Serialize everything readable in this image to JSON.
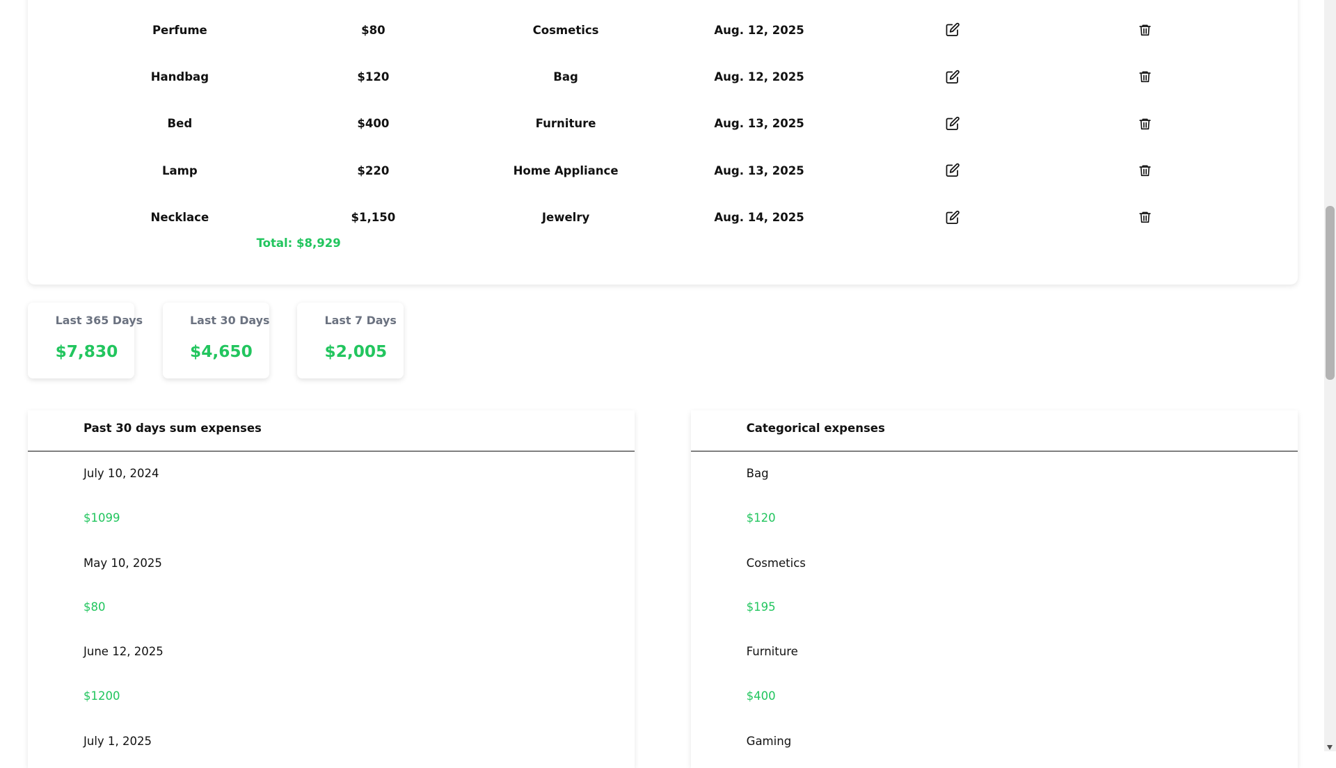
{
  "expenses": [
    {
      "name": "Perfume",
      "amount": "$80",
      "category": "Cosmetics",
      "date": "Aug. 12, 2025"
    },
    {
      "name": "Handbag",
      "amount": "$120",
      "category": "Bag",
      "date": "Aug. 12, 2025"
    },
    {
      "name": "Bed",
      "amount": "$400",
      "category": "Furniture",
      "date": "Aug. 13, 2025"
    },
    {
      "name": "Lamp",
      "amount": "$220",
      "category": "Home Appliance",
      "date": "Aug. 13, 2025"
    },
    {
      "name": "Necklace",
      "amount": "$1,150",
      "category": "Jewelry",
      "date": "Aug. 14, 2025"
    }
  ],
  "total_label": "Total: $8,929",
  "summary": [
    {
      "label": "Last 365 Days",
      "value": "$7,830"
    },
    {
      "label": "Last 30 Days",
      "value": "$4,650"
    },
    {
      "label": "Last 7 Days",
      "value": "$2,005"
    }
  ],
  "past30": {
    "title": "Past 30 days sum expenses",
    "items": [
      {
        "date": "July 10, 2024",
        "amount": "$1099"
      },
      {
        "date": "May 10, 2025",
        "amount": "$80"
      },
      {
        "date": "June 12, 2025",
        "amount": "$1200"
      },
      {
        "date": "July 1, 2025",
        "amount": ""
      }
    ]
  },
  "categorical": {
    "title": "Categorical expenses",
    "items": [
      {
        "category": "Bag",
        "amount": "$120"
      },
      {
        "category": "Cosmetics",
        "amount": "$195"
      },
      {
        "category": "Furniture",
        "amount": "$400"
      },
      {
        "category": "Gaming",
        "amount": ""
      }
    ]
  },
  "icons": {
    "edit": "edit-icon",
    "delete": "trash-icon"
  },
  "colors": {
    "accent": "#22c55e",
    "muted": "#6b7280"
  }
}
